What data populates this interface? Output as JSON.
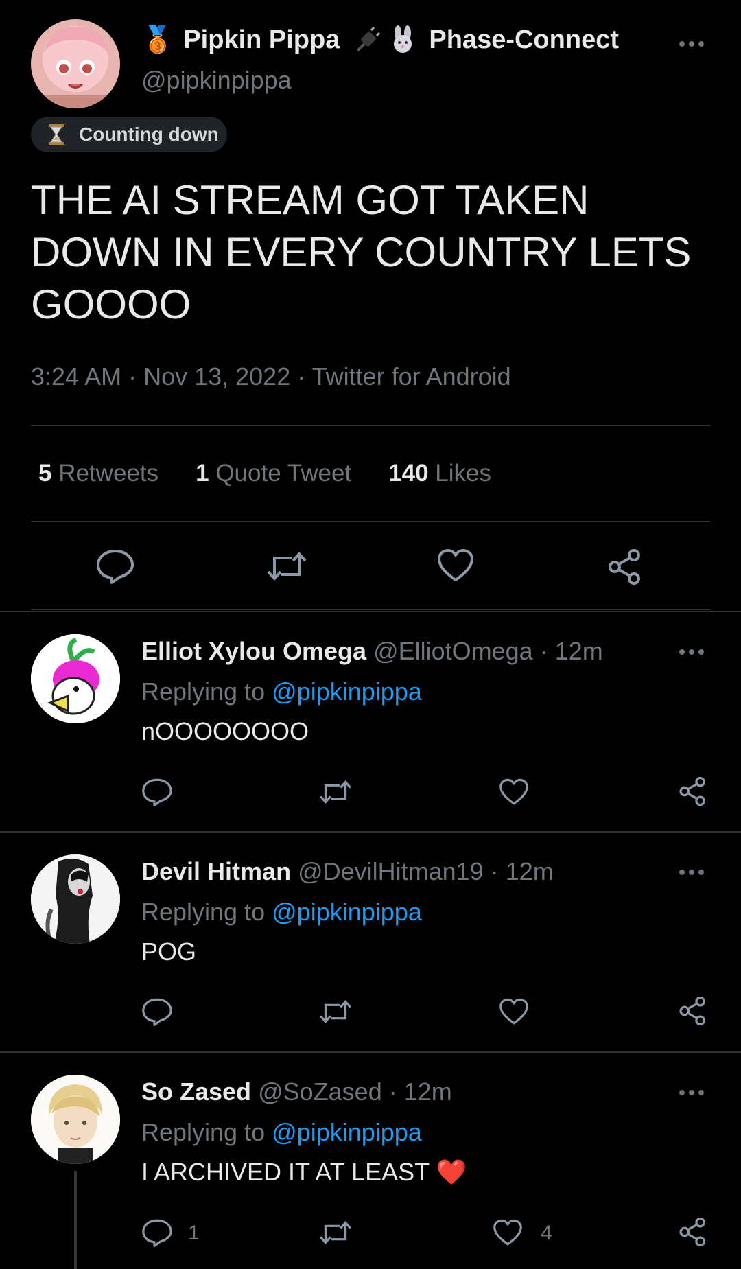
{
  "tweet": {
    "display_name": "Pipkin Pippa",
    "name_emoji_medal": "🥉",
    "name_suffix": "Phase-Connect",
    "handle": "@pipkinpippa",
    "badge_label": "Counting down",
    "text": "THE AI STREAM GOT TAKEN DOWN IN EVERY COUNTRY LETS GOOOO",
    "timestamp": "3:24 AM · Nov 13, 2022 · Twitter for Android",
    "stats": {
      "retweets_count": "5",
      "retweets_label": "Retweets",
      "quotes_count": "1",
      "quotes_label": "Quote Tweet",
      "likes_count": "140",
      "likes_label": "Likes"
    },
    "icons": [
      "reply-icon",
      "retweet-icon",
      "like-icon",
      "share-icon"
    ]
  },
  "replies": [
    {
      "display_name": "Elliot Xylou Omega",
      "handle": "@ElliotOmega",
      "time": "· 12m",
      "replying_prefix": "Replying to",
      "replying_to": "@pipkinpippa",
      "text": "nOOOOOOOO",
      "reply_count": "",
      "like_count": ""
    },
    {
      "display_name": "Devil Hitman",
      "handle": "@DevilHitman19",
      "time": "· 12m",
      "replying_prefix": "Replying to",
      "replying_to": "@pipkinpippa",
      "text": "POG",
      "reply_count": "",
      "like_count": ""
    },
    {
      "display_name": "So Zased",
      "handle": "@SoZased",
      "time": "· 12m",
      "replying_prefix": "Replying to",
      "replying_to": "@pipkinpippa",
      "text": "I ARCHIVED IT AT LEAST",
      "text_emoji": "❤️",
      "reply_count": "1",
      "like_count": "4"
    }
  ],
  "colors": {
    "background": "#000000",
    "text": "#e7e9ea",
    "muted": "#71767b",
    "link": "#1d9bf0",
    "divider": "#2f3336",
    "heart": "#f91880"
  }
}
